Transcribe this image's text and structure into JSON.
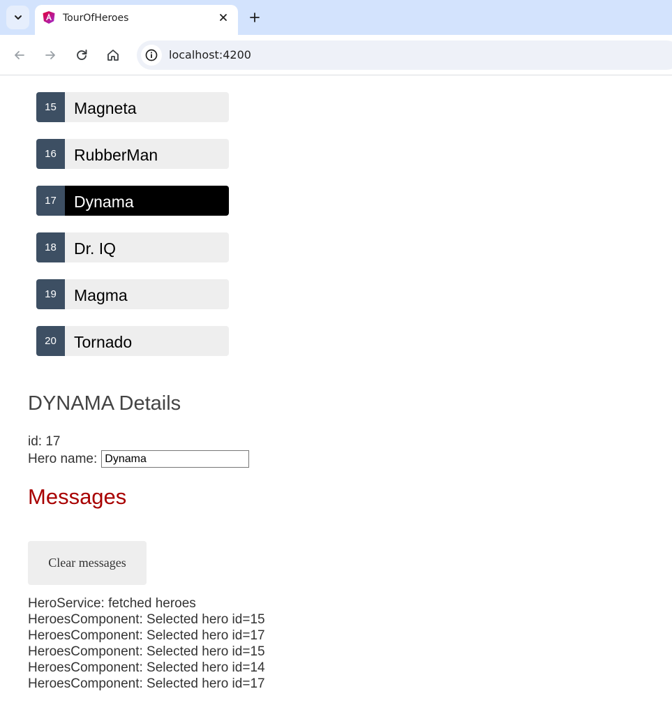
{
  "browser": {
    "tab_title": "TourOfHeroes",
    "url": "localhost:4200",
    "icons": {
      "tab_search": "chevron-down-icon",
      "favicon": "angular-logo-icon",
      "close": "close-icon",
      "new_tab": "plus-icon",
      "back": "arrow-left-icon",
      "forward": "arrow-right-icon",
      "reload": "reload-icon",
      "home": "home-icon",
      "site_info": "info-icon"
    }
  },
  "heroes": [
    {
      "id": "15",
      "name": "Magneta",
      "selected": false
    },
    {
      "id": "16",
      "name": "RubberMan",
      "selected": false
    },
    {
      "id": "17",
      "name": "Dynama",
      "selected": true
    },
    {
      "id": "18",
      "name": "Dr. IQ",
      "selected": false
    },
    {
      "id": "19",
      "name": "Magma",
      "selected": false
    },
    {
      "id": "20",
      "name": "Tornado",
      "selected": false
    }
  ],
  "details": {
    "title": "DYNAMA Details",
    "id_text": "id: 17",
    "name_label": "Hero name:",
    "name_value": "Dynama"
  },
  "messages": {
    "title": "Messages",
    "clear_label": "Clear messages",
    "lines": [
      "HeroService: fetched heroes",
      "HeroesComponent: Selected hero id=15",
      "HeroesComponent: Selected hero id=17",
      "HeroesComponent: Selected hero id=15",
      "HeroesComponent: Selected hero id=14",
      "HeroesComponent: Selected hero id=17"
    ]
  },
  "colors": {
    "tabstrip": "#d3e3fd",
    "badge": "#3d4f63",
    "item_bg": "#eeeeee",
    "selected_bg": "#000000",
    "messages_title": "#a80000"
  }
}
